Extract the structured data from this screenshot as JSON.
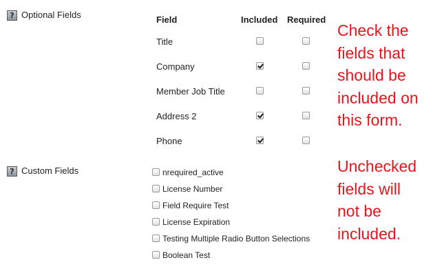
{
  "optional_section": {
    "help_icon": "?",
    "label": "Optional Fields",
    "headers": {
      "field": "Field",
      "included": "Included",
      "required": "Required"
    },
    "rows": [
      {
        "label": "Title",
        "included": false,
        "required": false
      },
      {
        "label": "Company",
        "included": true,
        "required": false
      },
      {
        "label": "Member Job Title",
        "included": false,
        "required": false
      },
      {
        "label": "Address 2",
        "included": true,
        "required": false
      },
      {
        "label": "Phone",
        "included": true,
        "required": false
      }
    ]
  },
  "custom_section": {
    "help_icon": "?",
    "label": "Custom Fields",
    "items": [
      {
        "label": "nrequired_active",
        "checked": false
      },
      {
        "label": "License Number",
        "checked": false
      },
      {
        "label": "Field Require Test",
        "checked": false
      },
      {
        "label": "License Expiration",
        "checked": false
      },
      {
        "label": "Testing Multiple Radio Button Selections",
        "checked": false
      },
      {
        "label": "Boolean Test",
        "checked": false
      }
    ]
  },
  "annotations": {
    "note1": [
      "Check the",
      "fields that",
      "should be",
      "included on",
      "this form."
    ],
    "note2": [
      "Unchecked",
      "fields will",
      "not be",
      "included."
    ],
    "color": "#e8141c"
  },
  "icons": {
    "help": "help-icon",
    "checkbox": "checkbox"
  }
}
